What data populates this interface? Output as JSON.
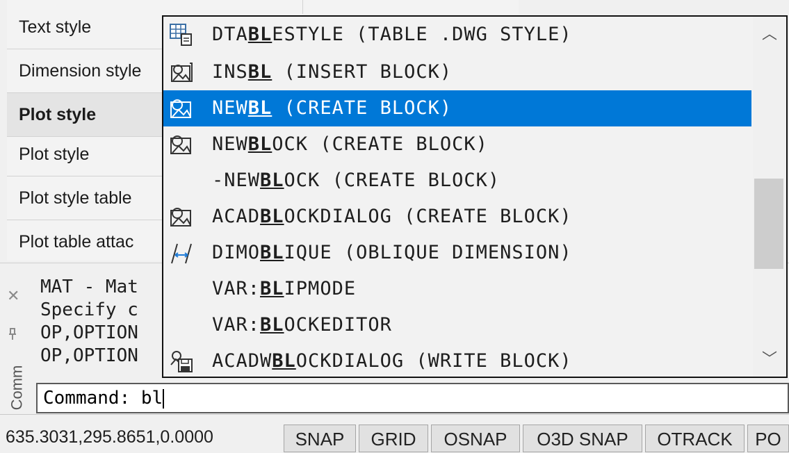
{
  "properties": {
    "rows": [
      {
        "label": "Text style",
        "bold": false
      },
      {
        "label": "Dimension style",
        "bold": false
      },
      {
        "label": "Plot style",
        "bold": true
      },
      {
        "label": "Plot style",
        "bold": false
      },
      {
        "label": "Plot style table",
        "bold": false
      },
      {
        "label": "Plot table attac",
        "bold": false
      }
    ]
  },
  "command_window": {
    "side_label": "Comm",
    "close_icon": "close-icon",
    "pin_icon": "pin-icon",
    "history": [
      "MAT - Mat",
      "Specify c",
      "OP,OPTION",
      "OP,OPTION"
    ],
    "command_line": "Command: bl"
  },
  "autocomplete": {
    "selected_index": 2,
    "items": [
      {
        "icon": "table-style-icon",
        "pre": "DTA",
        "hl": "BL",
        "post": "ESTYLE (TABLE .DWG STYLE)"
      },
      {
        "icon": "insert-block-icon",
        "pre": "INS",
        "hl": "BL",
        "post": " (INSERT BLOCK)"
      },
      {
        "icon": "create-block-icon",
        "pre": "NEW",
        "hl": "BL",
        "post": " (CREATE BLOCK)"
      },
      {
        "icon": "create-block-icon",
        "pre": "NEW",
        "hl": "BL",
        "post": "OCK (CREATE BLOCK)"
      },
      {
        "icon": "",
        "pre": "-NEW",
        "hl": "BL",
        "post": "OCK (CREATE BLOCK)"
      },
      {
        "icon": "create-block-icon",
        "pre": "ACAD",
        "hl": "BL",
        "post": "OCKDIALOG (CREATE BLOCK)"
      },
      {
        "icon": "dim-oblique-icon",
        "pre": "DIMO",
        "hl": "BL",
        "post": "IQUE (OBLIQUE DIMENSION)"
      },
      {
        "icon": "",
        "pre": "VAR:",
        "hl": "BL",
        "post": "IPMODE"
      },
      {
        "icon": "",
        "pre": "VAR:",
        "hl": "BL",
        "post": "OCKEDITOR"
      },
      {
        "icon": "write-block-icon",
        "pre": "ACADW",
        "hl": "BL",
        "post": "OCKDIALOG (WRITE BLOCK)"
      }
    ]
  },
  "status_bar": {
    "coords": "635.3031,295.8651,0.0000",
    "buttons": [
      "SNAP",
      "GRID",
      "OSNAP",
      "O3D SNAP",
      "OTRACK",
      "PO"
    ]
  },
  "colors": {
    "selection": "#0078d7",
    "panel_bg": "#f3f3f3"
  }
}
